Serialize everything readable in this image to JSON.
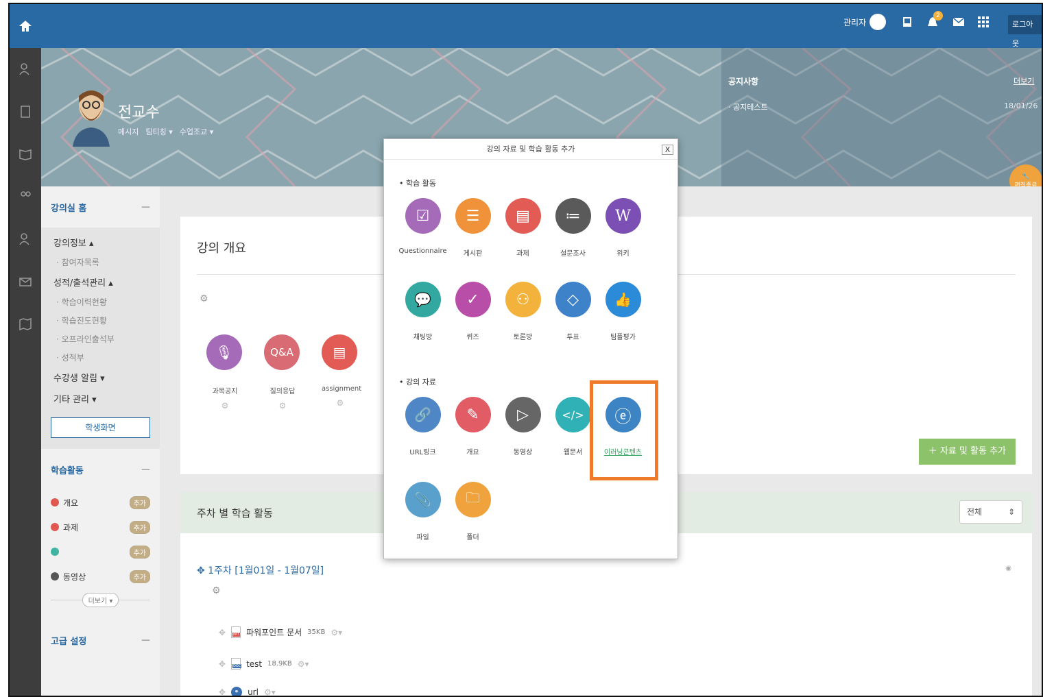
{
  "topbar": {
    "admin_label": "관리자",
    "notification_count": "2",
    "logout_label": "로그아웃"
  },
  "hero": {
    "professor_name": "전교수",
    "links": [
      "메시지",
      "팀티칭 ▾",
      "수업조교 ▾"
    ],
    "notice_title": "공지사항",
    "notice_more": "더보기",
    "notice_item": "· 공지테스트",
    "notice_date": "18/01/26",
    "edit_end_label": "편집종료"
  },
  "sidebar": {
    "home_label": "강의실 홈",
    "menu": [
      {
        "label": "강의정보 ▴",
        "type": "main"
      },
      {
        "label": "· 참여자목록",
        "type": "sub"
      },
      {
        "label": "성적/출석관리 ▴",
        "type": "main"
      },
      {
        "label": "· 학습이력현황",
        "type": "sub"
      },
      {
        "label": "· 학습진도현황",
        "type": "sub"
      },
      {
        "label": "· 오프라인출석부",
        "type": "sub"
      },
      {
        "label": "· 성적부",
        "type": "sub"
      },
      {
        "label": "수강생 알림 ▾",
        "type": "main"
      },
      {
        "label": "기타 관리 ▾",
        "type": "main"
      }
    ],
    "student_view_button": "학생화면",
    "activities_title": "학습활동",
    "activities": [
      {
        "label": "개요",
        "color": "#e0584f"
      },
      {
        "label": "과제",
        "color": "#e0584f"
      },
      {
        "label": "",
        "color": "#3fb4a2"
      },
      {
        "label": "동영상",
        "color": "#555555"
      }
    ],
    "add_label": "추가",
    "more_label": "더보기 ▾",
    "advanced_title": "고급 설정",
    "collapse_symbol": "—"
  },
  "main": {
    "overview_title": "강의 개요",
    "overview_items": [
      {
        "label": "과목공지",
        "icon": "mic-icon",
        "color": "#a56ab8",
        "glyph": "🎙"
      },
      {
        "label": "질의응답",
        "icon": "qa-icon",
        "color": "#d86b74",
        "glyph": "Q&A"
      },
      {
        "label": "assignment",
        "icon": "document-icon",
        "color": "#e25c55",
        "glyph": "▤"
      }
    ],
    "add_button": "＋ 자료 및 활동 추가",
    "weekly_title": "주차 별 학습 활동",
    "weekly_filter": "전체",
    "week_label": "✥ 1주차 [1월01일 - 1월07일]",
    "files": [
      {
        "name": "파워포인트 문서",
        "size": "35KB",
        "badge": "PPT",
        "badge_color": "#d9534f"
      },
      {
        "name": "test",
        "size": "18.9KB",
        "badge": "DOC",
        "badge_color": "#3a6fb0"
      },
      {
        "name": "url",
        "size": "",
        "badge": "",
        "badge_color": "#3a6fb0"
      }
    ]
  },
  "modal": {
    "title": "강의 자료 및 학습 활동 추가",
    "close_label": "X",
    "group_activities": "• 학습 활동",
    "group_materials": "• 강의 자료",
    "activities": [
      {
        "label": "Questionnaire",
        "icon": "questionnaire-icon",
        "color": "#a56ab8",
        "glyph": "☑"
      },
      {
        "label": "게시판",
        "icon": "board-icon",
        "color": "#f0923a",
        "glyph": "☰"
      },
      {
        "label": "과제",
        "icon": "assignment-icon",
        "color": "#e25c55",
        "glyph": "▤"
      },
      {
        "label": "설문조사",
        "icon": "survey-icon",
        "color": "#5a5a5a",
        "glyph": "≔"
      },
      {
        "label": "위키",
        "icon": "wiki-icon",
        "color": "#7b4fb3",
        "glyph": "W"
      },
      {
        "label": "채팅방",
        "icon": "chat-icon",
        "color": "#33a8a1",
        "glyph": "💬"
      },
      {
        "label": "퀴즈",
        "icon": "quiz-icon",
        "color": "#b94ea9",
        "glyph": "✓"
      },
      {
        "label": "토론방",
        "icon": "discussion-icon",
        "color": "#f2b23b",
        "glyph": "⚇"
      },
      {
        "label": "투표",
        "icon": "vote-icon",
        "color": "#3e82c9",
        "glyph": "◇"
      },
      {
        "label": "팀플평가",
        "icon": "thumbs-up-icon",
        "color": "#2b8bd8",
        "glyph": "👍"
      }
    ],
    "materials": [
      {
        "label": "URL링크",
        "icon": "link-icon",
        "color": "#4f86c6",
        "glyph": "🔗"
      },
      {
        "label": "개요",
        "icon": "pencil-icon",
        "color": "#e25c66",
        "glyph": "✎"
      },
      {
        "label": "동영상",
        "icon": "play-icon",
        "color": "#666666",
        "glyph": "▷"
      },
      {
        "label": "웹문서",
        "icon": "code-icon",
        "color": "#2fb1b6",
        "glyph": "</>"
      },
      {
        "label": "이러닝콘텐츠",
        "icon": "elearning-icon",
        "color": "#3d84c5",
        "glyph": "ⓔ"
      },
      {
        "label": "파일",
        "icon": "paperclip-icon",
        "color": "#5aa0cc",
        "glyph": "📎"
      },
      {
        "label": "폴더",
        "icon": "folder-icon",
        "color": "#f0a33d",
        "glyph": "🗀"
      }
    ],
    "highlight_color": "#ee7a2a"
  }
}
